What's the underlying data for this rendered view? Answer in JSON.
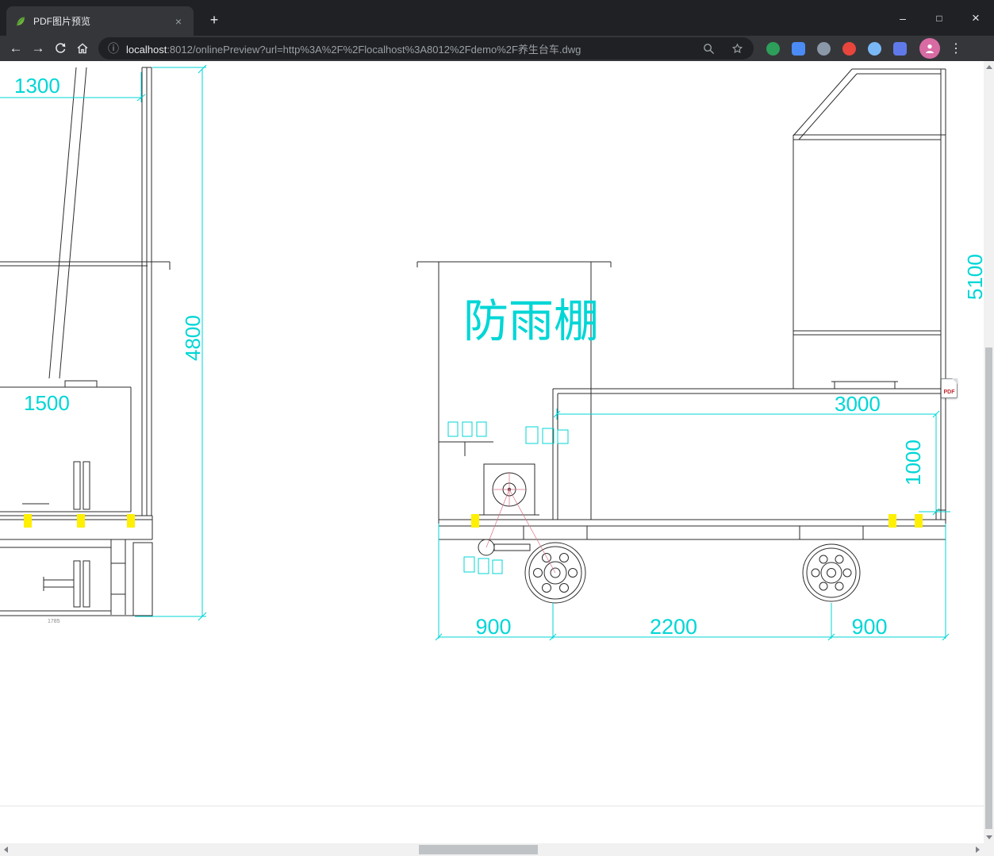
{
  "tab": {
    "title": "PDF图片预览",
    "close_icon": "×",
    "new_tab_icon": "+"
  },
  "window_controls": {
    "minimize": "–",
    "maximize": "□",
    "close": "×"
  },
  "toolbar": {
    "back_icon": "←",
    "forward_icon": "→",
    "info_icon": "ⓘ",
    "menu_icon": "⋮",
    "url": {
      "host": "localhost",
      "rest": ":8012/onlinePreview?url=http%3A%2F%2Flocalhost%3A8012%2Fdemo%2F养生台车.dwg"
    },
    "extensions": [
      {
        "name": "extension-1",
        "color": "#2e9e5b"
      },
      {
        "name": "extension-2",
        "color": "#4b8bf5"
      },
      {
        "name": "extension-3",
        "color": "#8a98a8"
      },
      {
        "name": "extension-4",
        "color": "#e8453c"
      },
      {
        "name": "extension-5",
        "color": "#7ab8f5"
      },
      {
        "name": "extension-6",
        "color": "#5f7ae8"
      }
    ],
    "avatar_color": "#d86ba3"
  },
  "drawing": {
    "labels": {
      "dim_1300": "1300",
      "dim_1500": "1500",
      "dim_4800": "4800",
      "dim_1785": "1785",
      "shelter": "防雨棚",
      "dim_5100": "5100",
      "dim_3000": "3000",
      "dim_1000": "1000",
      "dim_900_left": "900",
      "dim_2200": "2200",
      "dim_900_right": "900"
    },
    "colors": {
      "dimension": "#00d6d6",
      "highlight": "#ffef00",
      "centerline": "#d97086",
      "line": "#2b2b2b"
    },
    "pdf_badge_label": "PDF"
  }
}
